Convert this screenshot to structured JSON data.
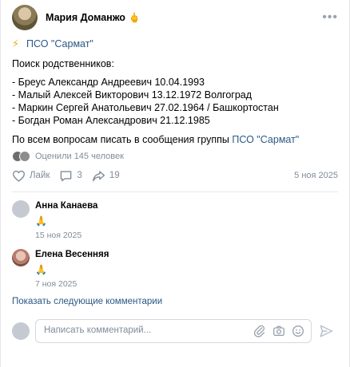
{
  "post": {
    "author": "Мария Доманжо",
    "author_emoji": "🖕",
    "group_label": "ПСО \"Сармат\"",
    "bolt_emoji": "⚡",
    "search_title": "Поиск родственников:",
    "people": [
      "- Бреус Александр Андреевич 10.04.1993",
      "- Малый Алексей Викторович 13.12.1972 Волгоград",
      "- Маркин Сергей Анатольевич 27.02.1964 / Башкортостан",
      "- Богдан Роман Александрович 21.12.1985"
    ],
    "contact_prefix": "По всем вопросам писать в сообщения группы ",
    "contact_link": "ПСО \"Сармат\"",
    "rated_text": "Оценили 145 человек",
    "like_label": "Лайк",
    "comments_count": "3",
    "shares_count": "19",
    "date": "5 ноя 2025"
  },
  "comments": [
    {
      "name": "Анна Канаева",
      "text": "🙏",
      "date": "15 ноя 2025"
    },
    {
      "name": "Елена Весенняя",
      "text": "🙏",
      "date": "7 ноя 2025"
    }
  ],
  "show_more_label": "Показать следующие комментарии",
  "composer": {
    "placeholder": "Написать комментарий..."
  },
  "colors": {
    "link": "#2a5885",
    "muted": "#818c99",
    "accent": "#2a5885"
  },
  "icons": [
    "more-icon",
    "bolt-icon",
    "heart-icon",
    "comment-icon",
    "share-icon",
    "attach-icon",
    "camera-icon",
    "emoji-icon",
    "send-icon"
  ]
}
